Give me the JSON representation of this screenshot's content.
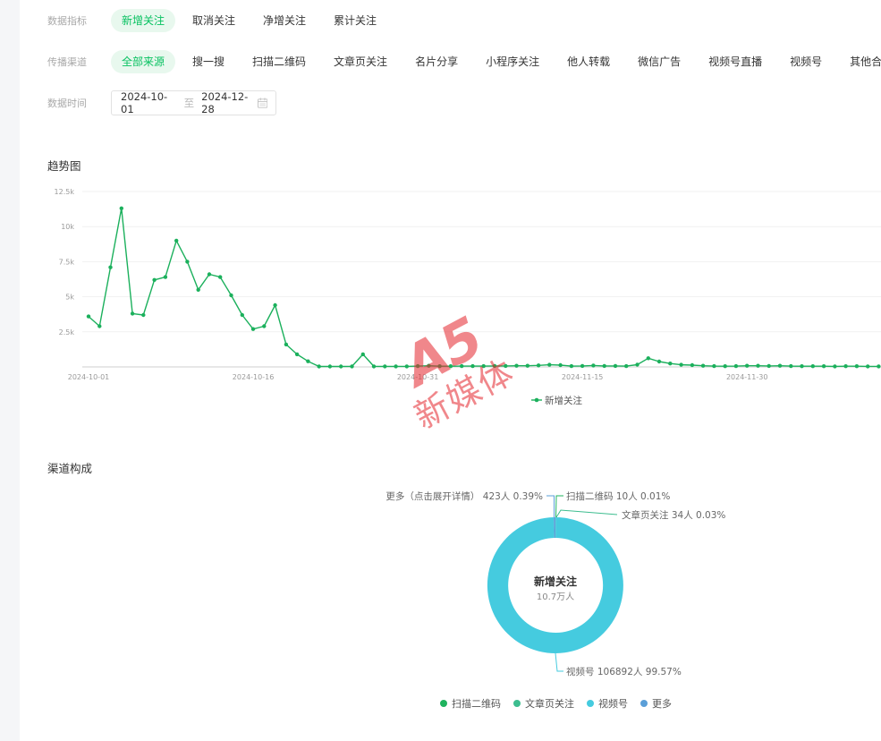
{
  "filters": {
    "metric": {
      "label": "数据指标",
      "options": [
        "新增关注",
        "取消关注",
        "净增关注",
        "累计关注"
      ],
      "selected_index": 0
    },
    "channel": {
      "label": "传播渠道",
      "options": [
        "全部来源",
        "搜一搜",
        "扫描二维码",
        "文章页关注",
        "名片分享",
        "小程序关注",
        "他人转载",
        "微信广告",
        "视频号直播",
        "视频号",
        "其他合"
      ],
      "selected_index": 0
    },
    "date": {
      "label": "数据时间",
      "start": "2024-10-01",
      "separator": "至",
      "end": "2024-12-28",
      "icon": "calendar-icon"
    }
  },
  "watermark": {
    "logo": "A5",
    "text": "新媒体"
  },
  "colors": {
    "accent": "#07c160",
    "accent_bg": "#e8f8ee"
  },
  "chart_data": [
    {
      "type": "line",
      "title": "趋势图",
      "x": [
        "2024-10-01",
        "2024-10-02",
        "2024-10-03",
        "2024-10-04",
        "2024-10-05",
        "2024-10-06",
        "2024-10-07",
        "2024-10-08",
        "2024-10-09",
        "2024-10-10",
        "2024-10-11",
        "2024-10-12",
        "2024-10-13",
        "2024-10-14",
        "2024-10-15",
        "2024-10-16",
        "2024-10-17",
        "2024-10-18",
        "2024-10-19",
        "2024-10-20",
        "2024-10-21",
        "2024-10-22",
        "2024-10-23",
        "2024-10-24",
        "2024-10-25",
        "2024-10-26",
        "2024-10-27",
        "2024-10-28",
        "2024-10-29",
        "2024-10-30",
        "2024-10-31",
        "2024-11-01",
        "2024-11-02",
        "2024-11-03",
        "2024-11-04",
        "2024-11-05",
        "2024-11-06",
        "2024-11-07",
        "2024-11-08",
        "2024-11-09",
        "2024-11-10",
        "2024-11-11",
        "2024-11-12",
        "2024-11-13",
        "2024-11-14",
        "2024-11-15",
        "2024-11-16",
        "2024-11-17",
        "2024-11-18",
        "2024-11-19",
        "2024-11-20",
        "2024-11-21",
        "2024-11-22",
        "2024-11-23",
        "2024-11-24",
        "2024-11-25",
        "2024-11-26",
        "2024-11-27",
        "2024-11-28",
        "2024-11-29",
        "2024-11-30",
        "2024-12-01",
        "2024-12-02",
        "2024-12-03",
        "2024-12-04",
        "2024-12-05",
        "2024-12-06",
        "2024-12-07",
        "2024-12-08",
        "2024-12-09",
        "2024-12-10",
        "2024-12-11",
        "2024-12-12"
      ],
      "x_tick_labels": [
        "2024-10-01",
        "2024-10-16",
        "2024-10-31",
        "2024-11-15",
        "2024-11-30"
      ],
      "y_ticks": [
        2500,
        5000,
        7500,
        10000,
        12500
      ],
      "y_tick_labels": [
        "2.5k",
        "5k",
        "7.5k",
        "10k",
        "12.5k"
      ],
      "ylim": [
        0,
        12500
      ],
      "grid": true,
      "legend_position": "bottom",
      "series": [
        {
          "name": "新增关注",
          "color": "#1bb05c",
          "values": [
            3600,
            2900,
            7100,
            11300,
            3800,
            3700,
            6200,
            6400,
            9000,
            7500,
            5500,
            6600,
            6400,
            5100,
            3700,
            2700,
            2900,
            4400,
            1600,
            900,
            400,
            30,
            30,
            30,
            40,
            900,
            40,
            40,
            40,
            40,
            60,
            80,
            50,
            50,
            60,
            60,
            60,
            70,
            70,
            80,
            80,
            110,
            150,
            130,
            60,
            70,
            100,
            70,
            70,
            60,
            160,
            620,
            380,
            240,
            150,
            130,
            80,
            60,
            50,
            60,
            80,
            80,
            70,
            80,
            60,
            50,
            50,
            50,
            40,
            50,
            50,
            40,
            40
          ]
        }
      ]
    },
    {
      "type": "pie",
      "title": "渠道构成",
      "center_label": "新增关注",
      "center_value": "10.7万人",
      "legend_position": "bottom",
      "slices": [
        {
          "name": "扫描二维码",
          "value": 10,
          "percent": 0.01,
          "color": "#1fb35e",
          "label": "扫描二维码 10人 0.01%"
        },
        {
          "name": "文章页关注",
          "value": 34,
          "percent": 0.03,
          "color": "#3dbd8f",
          "label": "文章页关注 34人 0.03%"
        },
        {
          "name": "视频号",
          "value": 106892,
          "percent": 99.57,
          "color": "#45cbdf",
          "label": "视频号 106892人 99.57%"
        },
        {
          "name": "更多",
          "value": 423,
          "percent": 0.39,
          "color": "#5b9fd8",
          "label": "更多（点击展开详情） 423人 0.39%"
        }
      ]
    }
  ]
}
